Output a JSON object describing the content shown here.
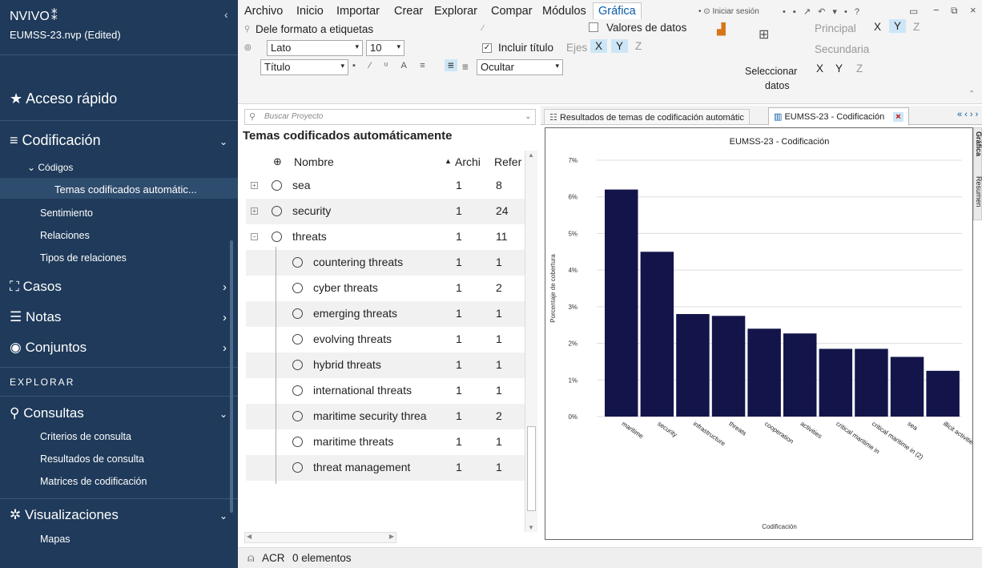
{
  "sidebar": {
    "logo": "NVIVO",
    "logo_dots": "⁑",
    "project": "EUMSS-23.nvp (Edited)",
    "quick_access": "Acceso rápido",
    "coding": "Codificación",
    "codes": "Códigos",
    "auto_themes": "Temas codificados automátic...",
    "sentiment": "Sentimiento",
    "relations": "Relaciones",
    "relation_types": "Tipos de relaciones",
    "cases": "Casos",
    "notes": "Notas",
    "sets": "Conjuntos",
    "explore": "EXPLORAR",
    "queries": "Consultas",
    "query_criteria": "Criterios de consulta",
    "query_results": "Resultados de consulta",
    "coding_matrices": "Matrices de codificación",
    "visualizations": "Visualizaciones",
    "maps": "Mapas"
  },
  "menu": {
    "file": "Archivo",
    "home": "Inicio",
    "import": "Importar",
    "create": "Crear",
    "explore": "Explorar",
    "share": "Compar",
    "modules": "Módulos",
    "chart": "Gráfica",
    "sign_in": "Iniciar sesión"
  },
  "ribbon": {
    "format_labels": "Dele formato a etiquetas",
    "font": "Lato",
    "size": "10",
    "title_sel": "Título",
    "data_values": "Valores de datos",
    "include_title": "Incluir título",
    "axes": "Ejes",
    "x": "X",
    "y": "Y",
    "z": "Z",
    "hide": "Ocultar",
    "select_data_1": "Seleccionar",
    "select_data_2": "datos",
    "primary": "Principal",
    "secondary": "Secundaria"
  },
  "search": {
    "placeholder": "Buscar Proyecto"
  },
  "panel_title": "Temas codificados automáticamente",
  "columns": {
    "name": "Nombre",
    "files": "Archi",
    "refs": "Refer"
  },
  "rows": [
    {
      "name": "sea",
      "files": "1",
      "refs": "8",
      "level": 0,
      "expander": "+"
    },
    {
      "name": "security",
      "files": "1",
      "refs": "24",
      "level": 0,
      "expander": "+"
    },
    {
      "name": "threats",
      "files": "1",
      "refs": "11",
      "level": 0,
      "expander": "−"
    },
    {
      "name": "countering threats",
      "files": "1",
      "refs": "1",
      "level": 1
    },
    {
      "name": "cyber threats",
      "files": "1",
      "refs": "2",
      "level": 1
    },
    {
      "name": "emerging threats",
      "files": "1",
      "refs": "1",
      "level": 1
    },
    {
      "name": "evolving threats",
      "files": "1",
      "refs": "1",
      "level": 1
    },
    {
      "name": "hybrid threats",
      "files": "1",
      "refs": "1",
      "level": 1
    },
    {
      "name": "international threats",
      "files": "1",
      "refs": "1",
      "level": 1
    },
    {
      "name": "maritime security threa",
      "files": "1",
      "refs": "2",
      "level": 1
    },
    {
      "name": "maritime threats",
      "files": "1",
      "refs": "1",
      "level": 1
    },
    {
      "name": "threat management",
      "files": "1",
      "refs": "1",
      "level": 1
    }
  ],
  "tabs": {
    "tab1": "Resultados de temas de codificación automátic",
    "tab2": "EUMSS-23 - Codificación",
    "side_tab1": "Gráfica",
    "side_tab2": "Resumen",
    "nav": "« ‹ › ›"
  },
  "status": {
    "user": "ACR",
    "items": "0 elementos"
  },
  "colors": {
    "sidebar": "#1f3a5a",
    "bar": "#13154a",
    "accent": "#cde6f7"
  },
  "chart_data": {
    "type": "bar",
    "title": "EUMSS-23 - Codificación",
    "xlabel": "Codificación",
    "ylabel": "Porcentaje de cobertura",
    "categories": [
      "maritime",
      "security",
      "infrastructure",
      "threats",
      "cooperation",
      "activities",
      "critical maritime in",
      "critical maritime in (2)",
      "sea",
      "illicit activities"
    ],
    "values": [
      6.2,
      4.5,
      2.8,
      2.75,
      2.4,
      2.27,
      1.85,
      1.85,
      1.63,
      1.25
    ],
    "ylim": [
      0,
      7
    ],
    "yticks": [
      "0%",
      "1%",
      "2%",
      "3%",
      "4%",
      "5%",
      "6%",
      "7%"
    ],
    "grid": true
  }
}
